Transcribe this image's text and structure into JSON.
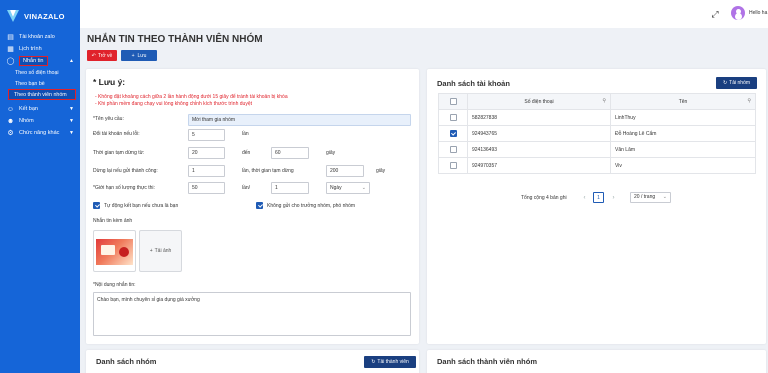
{
  "brand": {
    "name": "VINAZALO"
  },
  "sidebar": {
    "items": [
      {
        "label": "Tài khoản zalo",
        "icon": "id-card-icon"
      },
      {
        "label": "Lịch trình",
        "icon": "calendar-icon"
      },
      {
        "label": "Nhắn tin",
        "icon": "message-icon"
      },
      {
        "label": "Kết bạn",
        "icon": "add-user-icon"
      },
      {
        "label": "Nhóm",
        "icon": "group-icon"
      },
      {
        "label": "Chức năng khác",
        "icon": "settings-icon"
      }
    ],
    "subitems": [
      {
        "label": "Theo số điện thoại"
      },
      {
        "label": "Theo bạn bè"
      },
      {
        "label": "Theo thành viên nhóm"
      }
    ]
  },
  "header": {
    "username": "Hello ha"
  },
  "page": {
    "title": "NHẮN TIN THEO THÀNH VIÊN NHÓM",
    "back_label": "Trở về",
    "add_label": "Lưu"
  },
  "notes": {
    "title": "* Lưu ý:",
    "lines": [
      "- Không đặt khoảng cách giữa 2 lần hành động dưới 15 giây để tránh tài khoản bị khóa",
      "- Khi phần mềm đang chạy vui lòng không chỉnh kích thước trình duyệt"
    ]
  },
  "form": {
    "campaign_label": "*Tên yêu cầu:",
    "campaign_value": "Mời tham gia nhóm",
    "switch_account_label": "Đổi tài khoản nếu lỗi:",
    "switch_account_value": "5",
    "switch_account_unit": "lần",
    "pause_label": "Thời gian tạm dừng từ:",
    "pause_from": "20",
    "pause_to_label": "đến",
    "pause_to": "60",
    "pause_unit": "giây",
    "stop_label": "Dừng lại nếu gửi thành công:",
    "stop_value": "1",
    "stop_unit": "lần, thời gian tạm dừng",
    "stop_wait": "200",
    "stop_wait_unit": "giây",
    "limit_label": "*Giới hạn số lượng thực thi:",
    "limit_value": "50",
    "limit_per_label": "lần/",
    "limit_per_value": "1",
    "limit_period": "Ngày",
    "auto_friend_label": "Tự động kết bạn nếu chưa là bạn",
    "auto_friend_checked": true,
    "skip_admin_label": "Không gửi cho trưởng nhóm, phó nhóm",
    "skip_admin_checked": true,
    "attach_label": "Nhắn tin kèm ảnh",
    "upload_label": "Tải ảnh",
    "content_label": "*Nội dung nhắn tin:",
    "content_value": "Chào bạn, mình chuyên sỉ gia dụng giá xưởng"
  },
  "accounts": {
    "title": "Danh sách tài khoản",
    "reload_label": "Tải nhóm",
    "columns": [
      "Số điện thoại",
      "Tên"
    ],
    "rows": [
      {
        "phone": "582827838",
        "name": "LinhThuy",
        "checked": false
      },
      {
        "phone": "924943765",
        "name": "Đỗ Hoàng Lê Cẩm",
        "checked": true
      },
      {
        "phone": "924136493",
        "name": "Văn Lâm",
        "checked": false
      },
      {
        "phone": "924970357",
        "name": "Viv",
        "checked": false
      }
    ],
    "pagination": {
      "total_text": "Tổng cộng 4 bản ghi",
      "current_page": "1",
      "page_size": "20 / trang"
    }
  },
  "groups": {
    "title": "Danh sách nhóm",
    "load_label": "Tải thành viên"
  },
  "members": {
    "title": "Danh sách thành viên nhóm"
  },
  "colors": {
    "sidebar": "#1565d8",
    "accent": "#1f5bb5",
    "danger": "#e0222b"
  }
}
